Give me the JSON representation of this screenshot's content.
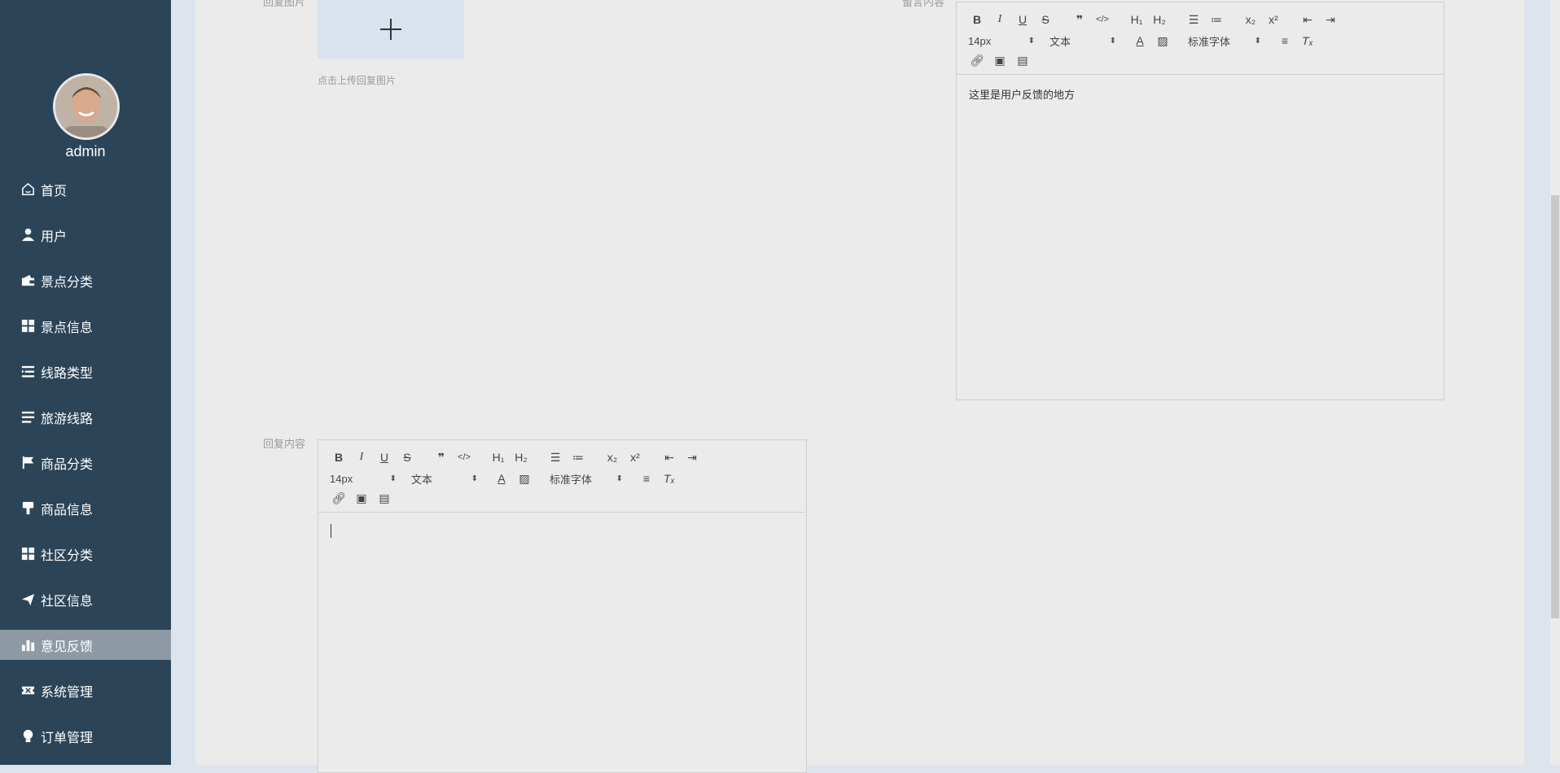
{
  "user": {
    "name": "admin"
  },
  "sidebar": {
    "items": [
      {
        "label": "首页",
        "icon": "home-icon"
      },
      {
        "label": "用户",
        "icon": "user-icon"
      },
      {
        "label": "景点分类",
        "icon": "wallet-icon"
      },
      {
        "label": "景点信息",
        "icon": "grid-icon"
      },
      {
        "label": "线路类型",
        "icon": "list-indent-icon"
      },
      {
        "label": "旅游线路",
        "icon": "list-icon"
      },
      {
        "label": "商品分类",
        "icon": "flag-icon"
      },
      {
        "label": "商品信息",
        "icon": "brush-icon"
      },
      {
        "label": "社区分类",
        "icon": "grid-icon"
      },
      {
        "label": "社区信息",
        "icon": "send-icon"
      },
      {
        "label": "意见反馈",
        "icon": "bar-chart-icon",
        "active": true
      },
      {
        "label": "系统管理",
        "icon": "ticket-icon"
      },
      {
        "label": "订单管理",
        "icon": "bulb-icon"
      }
    ]
  },
  "form": {
    "reply_image_label": "回复图片",
    "upload_tip": "点击上传回复图片",
    "message_label": "留言内容",
    "reply_content_label": "回复内容"
  },
  "editor_top": {
    "font_size": "14px",
    "text_type": "文本",
    "font_family": "标准字体",
    "content": "这里是用户反馈的地方"
  },
  "editor_bottom": {
    "font_size": "14px",
    "text_type": "文本",
    "font_family": "标准字体",
    "content": ""
  },
  "colors": {
    "sidebar_bg": "#2b4457",
    "active_item_bg": "#8e9aa3"
  }
}
